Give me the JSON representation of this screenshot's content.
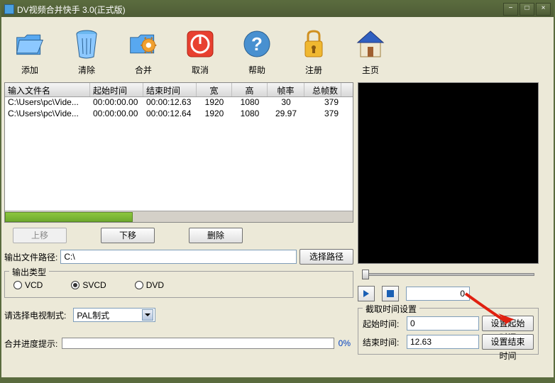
{
  "window": {
    "title": "DV视频合并快手 3.0(正式版)"
  },
  "toolbar": {
    "add": "添加",
    "clear": "清除",
    "merge": "合并",
    "cancel": "取消",
    "help": "帮助",
    "register": "注册",
    "home": "主页"
  },
  "columns": {
    "path": "输入文件名",
    "start": "起始时间",
    "end": "结束时间",
    "width": "宽",
    "height": "高",
    "fps": "帧率",
    "frames": "总帧数"
  },
  "rows": [
    {
      "path": "C:\\Users\\pc\\Vide...",
      "start": "00:00:00.00",
      "end": "00:00:12.63",
      "width": "1920",
      "height": "1080",
      "fps": "30",
      "frames": "379"
    },
    {
      "path": "C:\\Users\\pc\\Vide...",
      "start": "00:00:00.00",
      "end": "00:00:12.64",
      "width": "1920",
      "height": "1080",
      "fps": "29.97",
      "frames": "379"
    }
  ],
  "buttons": {
    "move_up": "上移",
    "move_down": "下移",
    "delete": "删除",
    "browse": "选择路径",
    "set_start": "设置起始时间",
    "set_end": "设置结束时间"
  },
  "labels": {
    "output_path": "输出文件路径:",
    "output_type": "输出类型",
    "tv_system": "请选择电视制式:",
    "progress": "合并进度提示:",
    "capture_settings": "截取时间设置",
    "start_time": "起始时间:",
    "end_time": "结束时间:"
  },
  "output": {
    "path": "C:\\",
    "types": {
      "vcd": "VCD",
      "svcd": "SVCD",
      "dvd": "DVD"
    },
    "selected_type": "svcd",
    "tv_system_value": "PAL制式"
  },
  "progress": {
    "percent": "0%"
  },
  "player": {
    "frame": "0"
  },
  "capture": {
    "start": "0",
    "end": "12.63"
  }
}
